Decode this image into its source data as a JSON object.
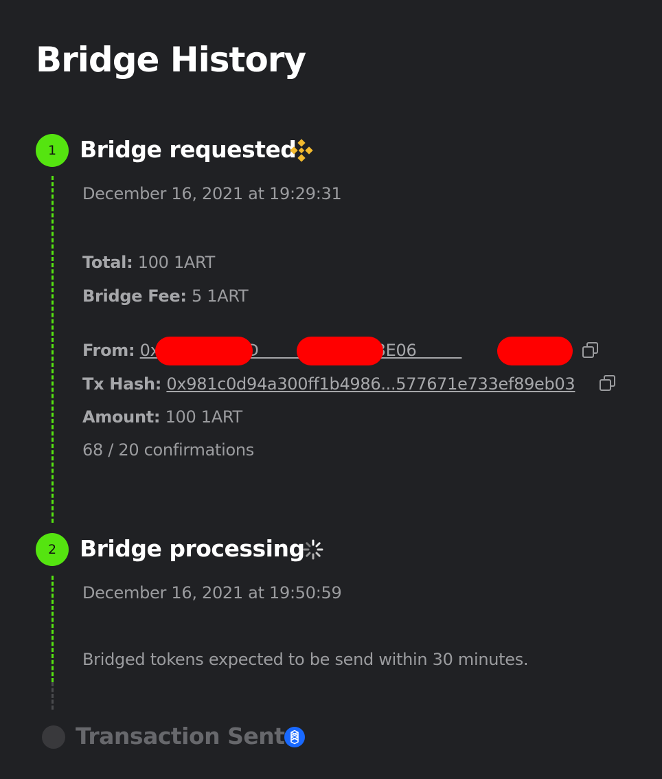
{
  "page": {
    "title": "Bridge History"
  },
  "steps": [
    {
      "number": "1",
      "title": "Bridge requested",
      "icon": "binance-logo-icon",
      "timestamp": "December 16, 2021 at 19:29:31",
      "total_label": "Total:",
      "total_value": "100 1ART",
      "fee_label": "Bridge Fee:",
      "fee_value": "5 1ART",
      "from_label": "From:",
      "from_value": "0x         7898D         C2192c93E06         ",
      "txhash_label": "Tx Hash:",
      "txhash_value": "0x981c0d94a300ff1b4986...577671e733ef89eb03",
      "amount_label": "Amount:",
      "amount_value": "100 1ART",
      "confirmations": "68 / 20 confirmations"
    },
    {
      "number": "2",
      "title": "Bridge processing",
      "icon": "loading-spinner-icon",
      "timestamp": "December 16, 2021 at 19:50:59",
      "note": "Bridged tokens expected to be send within 30 minutes."
    },
    {
      "title": "Transaction Sent",
      "icon": "fantom-logo-icon"
    }
  ],
  "colors": {
    "background": "#202124",
    "accent_green": "#55e410",
    "binance_yellow": "#f3ba2f",
    "fantom_blue": "#1969ff",
    "redaction": "#ff0000"
  }
}
